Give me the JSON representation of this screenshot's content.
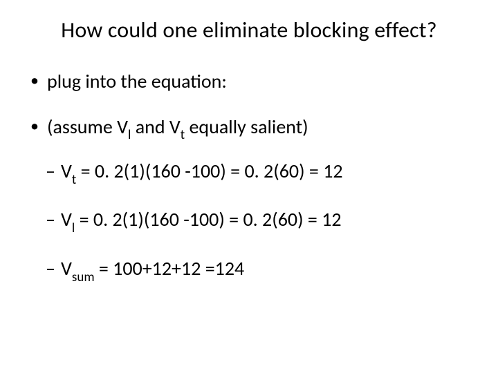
{
  "title": "How could one eliminate blocking effect?",
  "bullets": {
    "b1": "plug into the equation:",
    "b2_pre": "(assume V",
    "b2_sub1": "l",
    "b2_mid": " and V",
    "b2_sub2": "t",
    "b2_post": " equally salient)"
  },
  "eq": {
    "vt_pre": "V",
    "vt_sub": "t",
    "vt_rest": " = 0. 2(1)(160 -100) = 0. 2(60) = 12",
    "vl_pre": "V",
    "vl_sub": "l",
    "vl_rest": " = 0. 2(1)(160 -100) = 0. 2(60) = 12",
    "vs_pre": "V",
    "vs_sub": "sum",
    "vs_rest": " = 100+12+12 =124"
  }
}
